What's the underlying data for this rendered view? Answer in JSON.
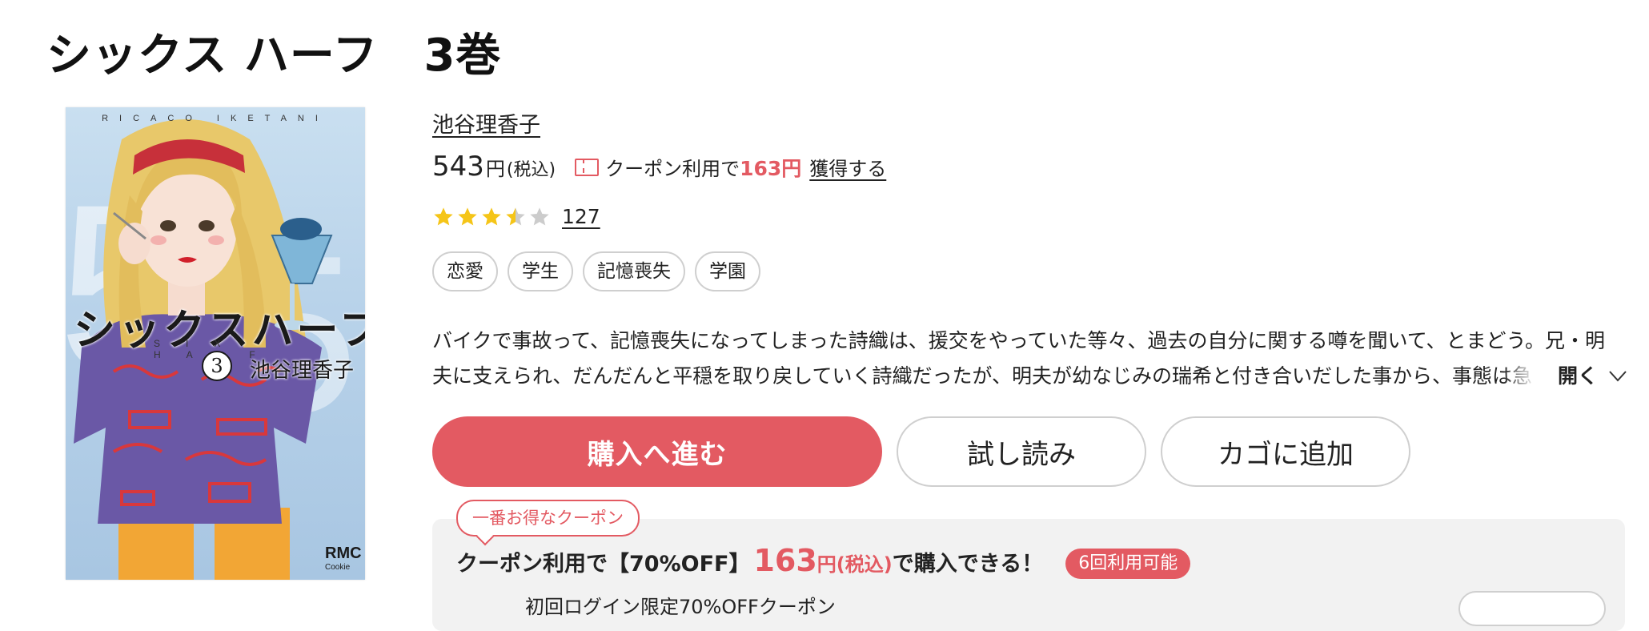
{
  "page": {
    "title": "シックス ハーフ　3巻"
  },
  "cover": {
    "top_text": "RICACO IKETANI",
    "jp_title": "シックスハーフ",
    "en_title": "SIX HALF",
    "volume": "3",
    "author": "池谷理香子",
    "label": "RMC",
    "label_sub": "Cookie"
  },
  "product": {
    "author": "池谷理香子",
    "price": "543",
    "price_unit": "円",
    "price_tax": "(税込)",
    "coupon_text": "クーポン利用で",
    "coupon_price": "163円",
    "get_link": "獲得する",
    "rating": 3.5,
    "review_count": "127",
    "tags": [
      "恋愛",
      "学生",
      "記憶喪失",
      "学園"
    ],
    "description_line1": "バイクで事故って、記憶喪失になってしまった詩織は、援交をやっていた等々、過去の自分に関する噂を聞いて、とまどう。兄・明",
    "description_line2": "夫に支えられ、だんだんと平穏を取り戻していく詩織だったが、明夫が幼なじみの瑞希と付き合いだした事から、事態は急",
    "open_more": "開く"
  },
  "buttons": {
    "buy": "購入へ進む",
    "try_read": "試し読み",
    "add_cart": "カゴに追加"
  },
  "coupon_box": {
    "balloon": "一番お得なクーポン",
    "line_a": "クーポン利用で【70%OFF】",
    "price": "163",
    "unit": "円(税込)",
    "line_b": "で購入できる！",
    "uses": "6回利用可能",
    "sub": "初回ログイン限定70%OFFクーポン"
  },
  "colors": {
    "accent": "#e35a62",
    "star": "#f5c518",
    "star_empty": "#cccccc",
    "border": "#cfcfcf",
    "coupon_bg": "#f2f2f2"
  }
}
